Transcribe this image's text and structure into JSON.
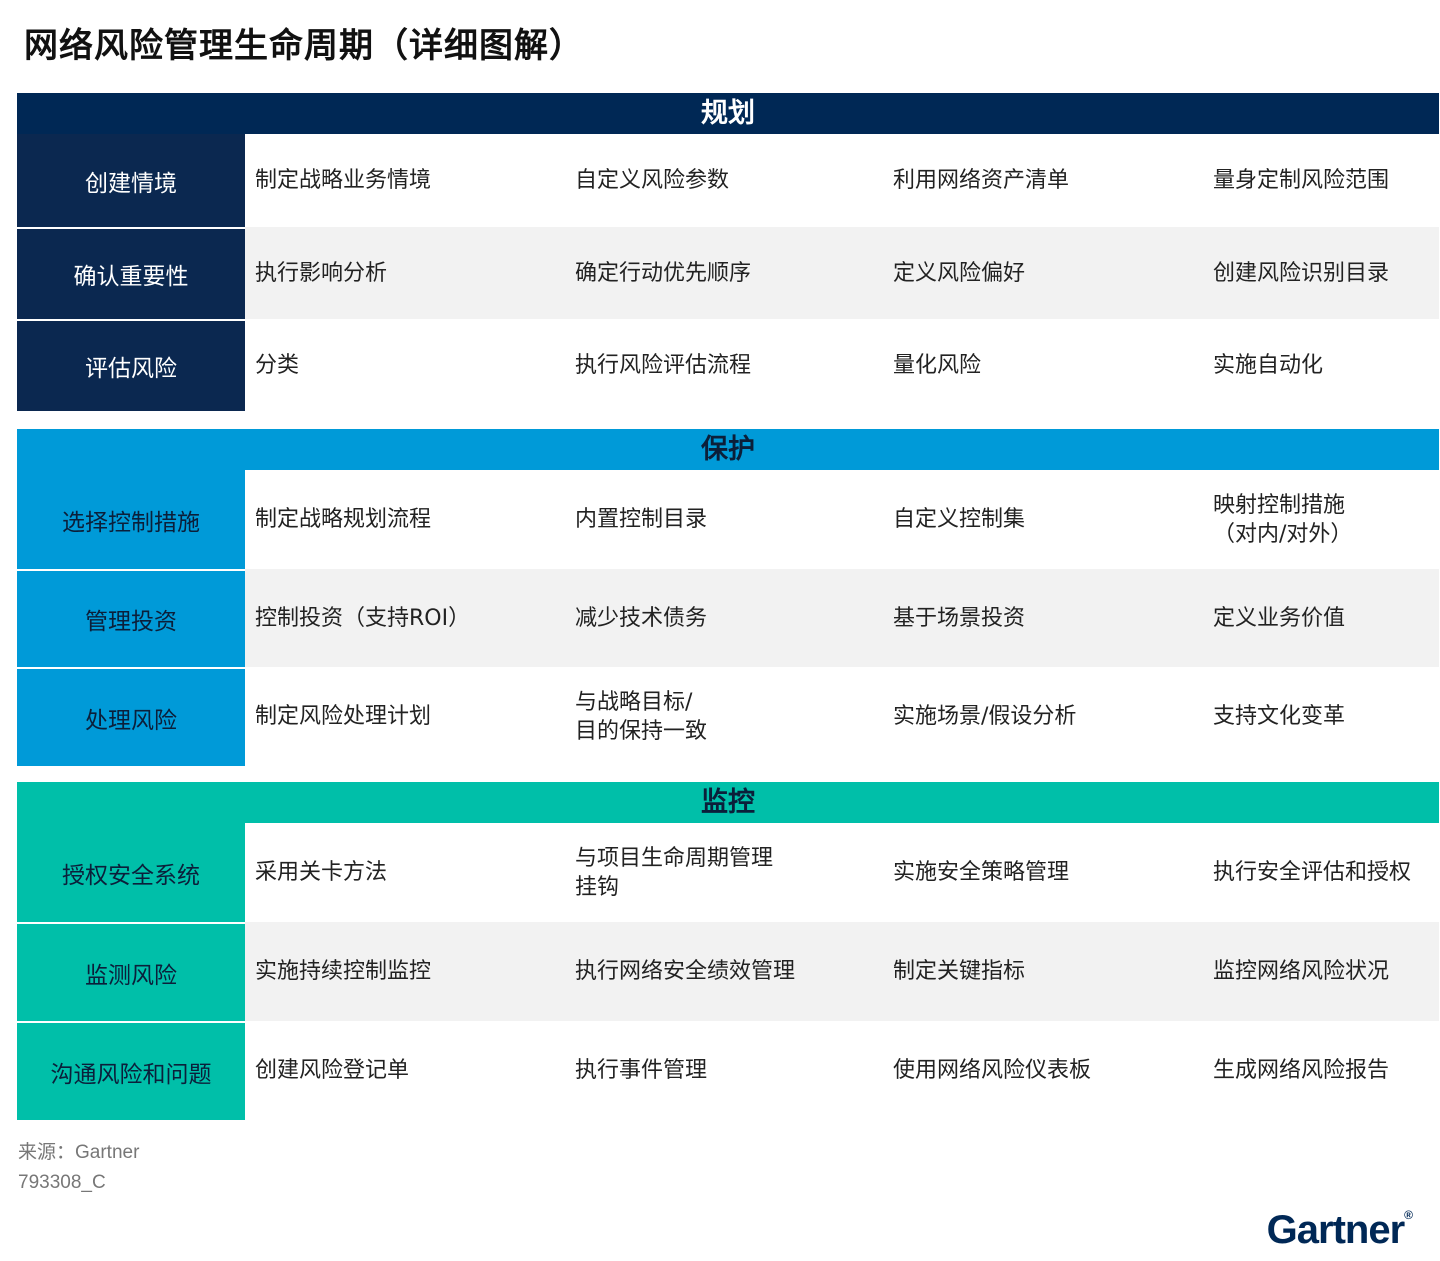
{
  "title": "网络风险管理生命周期（详细图解）",
  "sections": [
    {
      "header": "规划",
      "rows": [
        {
          "label": "创建情境",
          "cells": [
            "制定战略业务情境",
            "自定义风险参数",
            "利用网络资产清单",
            "量身定制风险范围"
          ]
        },
        {
          "label": "确认重要性",
          "cells": [
            "执行影响分析",
            "确定行动优先顺序",
            "定义风险偏好",
            "创建风险识别目录"
          ]
        },
        {
          "label": "评估风险",
          "cells": [
            "分类",
            "执行风险评估流程",
            "量化风险",
            "实施自动化"
          ]
        }
      ]
    },
    {
      "header": "保护",
      "rows": [
        {
          "label": "选择控制措施",
          "cells": [
            "制定战略规划流程",
            "内置控制目录",
            "自定义控制集",
            "映射控制措施\n（对内/对外）"
          ]
        },
        {
          "label": "管理投资",
          "cells": [
            "控制投资（支持ROI）",
            "减少技术债务",
            "基于场景投资",
            "定义业务价值"
          ]
        },
        {
          "label": "处理风险",
          "cells": [
            "制定风险处理计划",
            "与战略目标/\n目的保持一致",
            "实施场景/假设分析",
            "支持文化变革"
          ]
        }
      ]
    },
    {
      "header": "监控",
      "rows": [
        {
          "label": "授权安全系统",
          "cells": [
            "采用关卡方法",
            "与项目生命周期管理\n挂钩",
            "实施安全策略管理",
            "执行安全评估和授权"
          ]
        },
        {
          "label": "监测风险",
          "cells": [
            "实施持续控制监控",
            "执行网络安全绩效管理",
            "制定关键指标",
            "监控网络风险状况"
          ]
        },
        {
          "label": "沟通风险和问题",
          "cells": [
            "创建风险登记单",
            "执行事件管理",
            "使用网络风险仪表板",
            "生成网络风险报告"
          ]
        }
      ]
    }
  ],
  "footer": {
    "source": "来源：Gartner",
    "code": "793308_C"
  },
  "logo": {
    "text": "Gartner",
    "mark": "®"
  }
}
